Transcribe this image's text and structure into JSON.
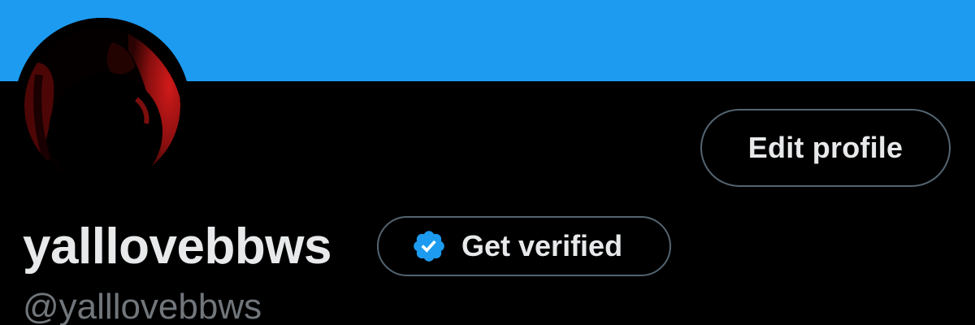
{
  "colors": {
    "banner": "#1d9bf0",
    "background": "#000000",
    "text_primary": "#e7e9ea",
    "text_secondary": "#71767b",
    "button_border": "#536471",
    "verified_badge": "#1d9bf0"
  },
  "profile": {
    "display_name": "yalllovebbws",
    "handle": "@yalllovebbws",
    "avatar_icon": "avatar-photo"
  },
  "actions": {
    "edit_profile_label": "Edit profile",
    "get_verified_label": "Get verified",
    "get_verified_icon": "verified-badge-icon"
  }
}
